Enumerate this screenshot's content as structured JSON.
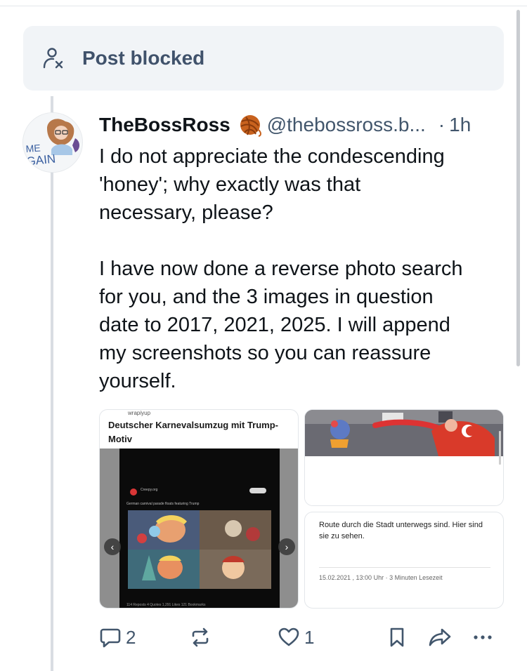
{
  "blocked": {
    "icon": "person-x-icon",
    "label": "Post blocked"
  },
  "post": {
    "author": {
      "display_name": "TheBossRoss",
      "emoji": "yarn-ball-icon",
      "handle": "@thebossross.b...",
      "separator": "·",
      "time": "1h",
      "avatar_text_top": "ME",
      "avatar_text_bottom": "AGAIN"
    },
    "text": "I do not appreciate the condescending\n'honey'; why exactly was that\nnecessary, please?\n\nI have now done a reverse photo search\nfor you, and the 3 images in question\ndate to 2017, 2021, 2025. I will append\nmy screenshots so you can reassure\nyourself.",
    "media": {
      "left": {
        "top_fragment": "wrapiyup",
        "title": "Deutscher Karnevalsumzug mit Trump-Motiv",
        "account": "Creepy.org",
        "tweet_text": "German carnival parade floats featuring Trump",
        "stats": "114 Reposts  4 Quotes  1,291 Likes  121 Bookmarks"
      },
      "right_bottom": {
        "text": "Route durch die Stadt unterwegs sind. Hier sind sie zu sehen.",
        "date": "15.02.2021 , 13:00 Uhr · 3 Minuten Lesezeit"
      }
    },
    "actions": {
      "reply_count": "2",
      "like_count": "1"
    }
  },
  "colors": {
    "muted": "#42566c",
    "blocked_bg": "#f1f4f7",
    "thread_line": "#d9dde2"
  }
}
